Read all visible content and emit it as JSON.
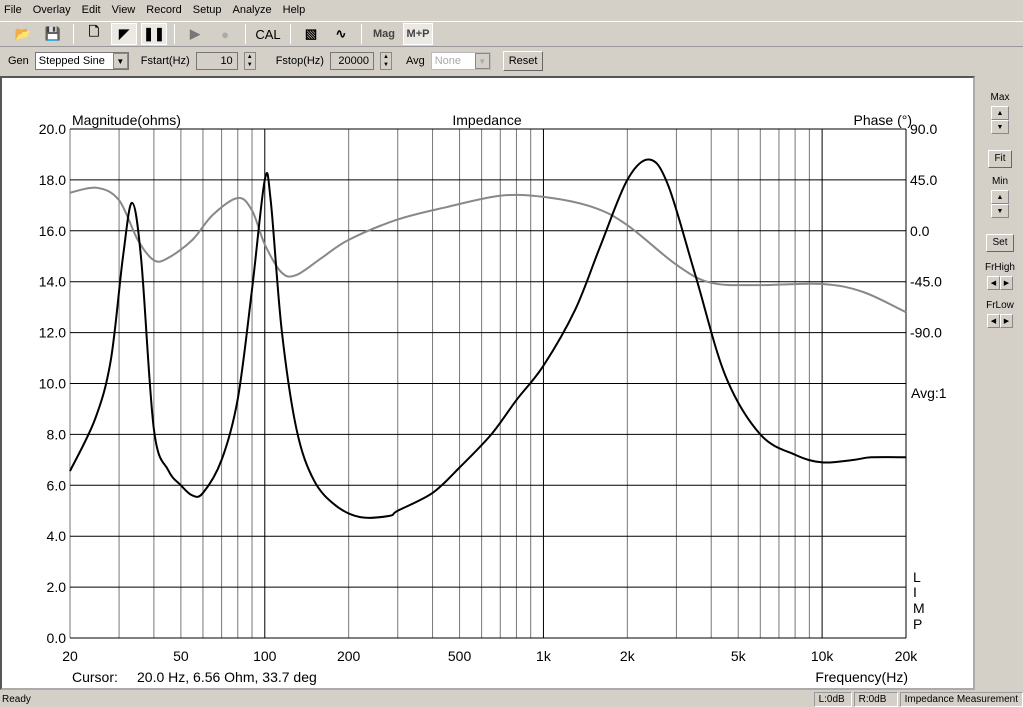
{
  "menu": [
    "File",
    "Overlay",
    "Edit",
    "View",
    "Record",
    "Setup",
    "Analyze",
    "Help"
  ],
  "toolbar": {
    "cal": "CAL",
    "mag": "Mag",
    "mp": "M+P"
  },
  "gen": {
    "label": "Gen",
    "value": "Stepped Sine",
    "fstart_label": "Fstart(Hz)",
    "fstart": "10",
    "fstop_label": "Fstop(Hz)",
    "fstop": "20000",
    "avg_label": "Avg",
    "avg": "None",
    "reset": "Reset"
  },
  "side": {
    "max": "Max",
    "fit": "Fit",
    "min": "Min",
    "set": "Set",
    "frhigh": "FrHigh",
    "frlow": "FrLow"
  },
  "status": {
    "left": "Ready",
    "l": "L:0dB",
    "r": "R:0dB",
    "mode": "Impedance Measurement"
  },
  "plot": {
    "cursor_label": "Cursor:",
    "cursor": "20.0 Hz, 6.56 Ohm, 33.7 deg",
    "avg": "Avg:1",
    "limp": [
      "L",
      "I",
      "M",
      "P"
    ]
  },
  "chart_data": {
    "type": "line",
    "title": "Impedance",
    "ylabel": "Magnitude(ohms)",
    "y2label": "Phase (°)",
    "xlabel": "Frequency(Hz)",
    "xscale": "log",
    "xlim": [
      20,
      20000
    ],
    "ylim": [
      0,
      20
    ],
    "y2lim": [
      -90,
      90
    ],
    "xticks": [
      {
        "v": 20,
        "l": "20"
      },
      {
        "v": 50,
        "l": "50"
      },
      {
        "v": 100,
        "l": "100"
      },
      {
        "v": 200,
        "l": "200"
      },
      {
        "v": 500,
        "l": "500"
      },
      {
        "v": 1000,
        "l": "1k"
      },
      {
        "v": 2000,
        "l": "2k"
      },
      {
        "v": 5000,
        "l": "5k"
      },
      {
        "v": 10000,
        "l": "10k"
      },
      {
        "v": 20000,
        "l": "20k"
      }
    ],
    "yticks": [
      "0.0",
      "2.0",
      "4.0",
      "6.0",
      "8.0",
      "10.0",
      "12.0",
      "14.0",
      "16.0",
      "18.0",
      "20.0"
    ],
    "y2ticks": [
      "90.0",
      "45.0",
      "0.0",
      "-45.0",
      "-90.0"
    ],
    "series": [
      {
        "name": "Magnitude",
        "color": "#000000",
        "points": [
          [
            20,
            6.56
          ],
          [
            24.6,
            8.6
          ],
          [
            28,
            10.9
          ],
          [
            31,
            15
          ],
          [
            33.4,
            17.1
          ],
          [
            36,
            14.9
          ],
          [
            40,
            8.2
          ],
          [
            45,
            6.6
          ],
          [
            50,
            6.0
          ],
          [
            55,
            5.6
          ],
          [
            60,
            5.7
          ],
          [
            70,
            7.0
          ],
          [
            80,
            9.4
          ],
          [
            90,
            13.7
          ],
          [
            100,
            18.0
          ],
          [
            105,
            17.2
          ],
          [
            115,
            12.1
          ],
          [
            130,
            8.2
          ],
          [
            150,
            6.2
          ],
          [
            180,
            5.2
          ],
          [
            220,
            4.75
          ],
          [
            280,
            4.8
          ],
          [
            300,
            5.0
          ],
          [
            400,
            5.7
          ],
          [
            500,
            6.7
          ],
          [
            650,
            8.0
          ],
          [
            800,
            9.35
          ],
          [
            1000,
            10.7
          ],
          [
            1300,
            12.9
          ],
          [
            1600,
            15.4
          ],
          [
            2000,
            18.0
          ],
          [
            2400,
            18.8
          ],
          [
            2800,
            17.8
          ],
          [
            3500,
            14.3
          ],
          [
            4500,
            10.3
          ],
          [
            6000,
            8.0
          ],
          [
            8000,
            7.2
          ],
          [
            10000,
            6.9
          ],
          [
            13000,
            7.0
          ],
          [
            15000,
            7.1
          ],
          [
            20000,
            7.1
          ]
        ]
      },
      {
        "name": "Phase",
        "color": "#888888",
        "axis": "y2",
        "points": [
          [
            20,
            33.7
          ],
          [
            25,
            38
          ],
          [
            30,
            27
          ],
          [
            35,
            -8
          ],
          [
            40,
            -26
          ],
          [
            45,
            -24
          ],
          [
            55,
            -8
          ],
          [
            65,
            14
          ],
          [
            80,
            29
          ],
          [
            90,
            18
          ],
          [
            100,
            -12
          ],
          [
            115,
            -37
          ],
          [
            130,
            -39
          ],
          [
            160,
            -24
          ],
          [
            200,
            -8
          ],
          [
            300,
            10
          ],
          [
            450,
            21
          ],
          [
            700,
            31
          ],
          [
            1000,
            30
          ],
          [
            1500,
            21
          ],
          [
            2000,
            5
          ],
          [
            3000,
            -30
          ],
          [
            4000,
            -46
          ],
          [
            6000,
            -48
          ],
          [
            10000,
            -47
          ],
          [
            14000,
            -54
          ],
          [
            20000,
            -72
          ]
        ]
      }
    ]
  }
}
